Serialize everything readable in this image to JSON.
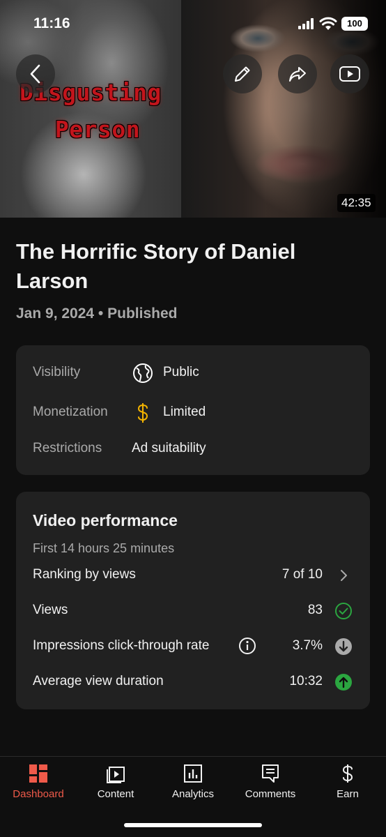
{
  "status_bar": {
    "time": "11:16",
    "battery": "100"
  },
  "thumbnail": {
    "overlay_line1": "Disgusting",
    "overlay_line2": "Person",
    "duration": "42:35"
  },
  "header_icons": [
    "back-icon",
    "pencil-icon",
    "share-icon",
    "youtube-play-icon"
  ],
  "video": {
    "title": "The Horrific Story of Daniel Larson",
    "meta": "Jan 9, 2024 • Published"
  },
  "status_card": {
    "visibility_label": "Visibility",
    "visibility_value": "Public",
    "visibility_icon": "globe-icon",
    "monetization_label": "Monetization",
    "monetization_value": "Limited",
    "monetization_icon": "dollar-icon",
    "monetization_color": "#f4b400",
    "restrictions_label": "Restrictions",
    "restrictions_value": "Ad suitability"
  },
  "performance": {
    "title": "Video performance",
    "subtitle": "First 14 hours 25 minutes",
    "rows": [
      {
        "label": "Ranking by views",
        "value": "7 of 10",
        "indicator": "chevron-right-icon"
      },
      {
        "label": "Views",
        "value": "83",
        "indicator": "check-circle-icon",
        "indicator_color": "#2ba640"
      },
      {
        "label": "Impressions click-through rate",
        "value": "3.7%",
        "indicator": "down-arrow-icon",
        "indicator_color": "#aaaaaa"
      },
      {
        "label": "Average view duration",
        "value": "10:32",
        "indicator": "up-arrow-icon",
        "indicator_color": "#2ba640"
      }
    ]
  },
  "bottom_nav": {
    "items": [
      {
        "label": "Dashboard",
        "icon": "dashboard-icon",
        "active": true
      },
      {
        "label": "Content",
        "icon": "content-icon",
        "active": false
      },
      {
        "label": "Analytics",
        "icon": "analytics-icon",
        "active": false
      },
      {
        "label": "Comments",
        "icon": "comments-icon",
        "active": false
      },
      {
        "label": "Earn",
        "icon": "earn-icon",
        "active": false
      }
    ],
    "active_color": "#ef5a4a"
  }
}
